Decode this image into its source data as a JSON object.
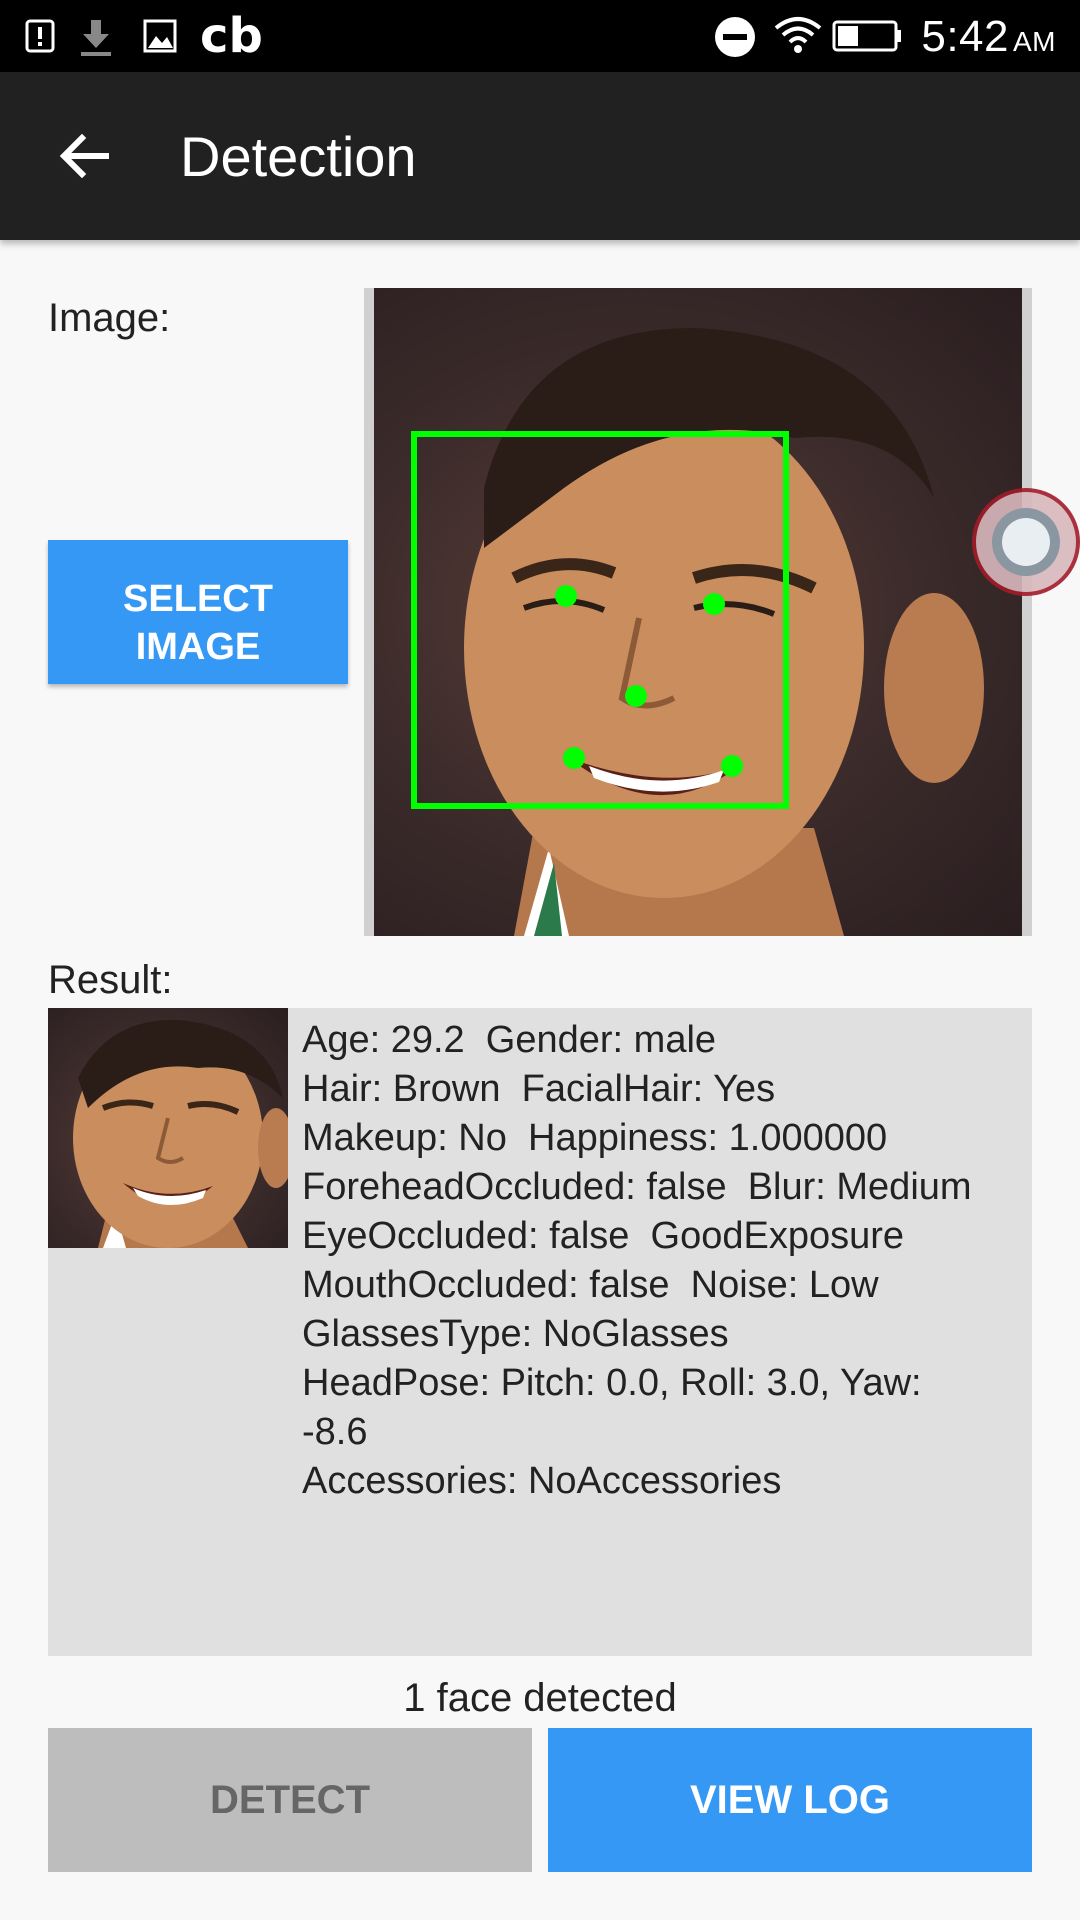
{
  "status_bar": {
    "time": "5:42",
    "ampm": "AM",
    "app_text": "cb",
    "icons": [
      "alert-icon",
      "download-icon",
      "image-icon",
      "dnd-icon",
      "wifi-icon",
      "battery-icon"
    ]
  },
  "app_bar": {
    "title": "Detection",
    "back_icon": "arrow-back-icon"
  },
  "image_section": {
    "label": "Image:",
    "select_button": "SELECT\nIMAGE",
    "detection_color": "#00ff00"
  },
  "result_section": {
    "label": "Result:",
    "lines": [
      "Age: 29.2  Gender: male",
      "Hair: Brown  FacialHair: Yes",
      "Makeup: No  Happiness: 1.000000",
      "ForeheadOccluded: false  Blur: Medium",
      "EyeOccluded: false  GoodExposure",
      "MouthOccluded: false  Noise: Low",
      "GlassesType: NoGlasses",
      "HeadPose: Pitch: 0.0, Roll: 3.0, Yaw:",
      "-8.6",
      "Accessories: NoAccessories"
    ]
  },
  "faces_detected": "1 face detected",
  "buttons": {
    "detect": "DETECT",
    "view_log": "VIEW LOG"
  },
  "colors": {
    "accent": "#3498f4",
    "app_bar": "#212121",
    "disabled_button": "#bdbdbd"
  }
}
